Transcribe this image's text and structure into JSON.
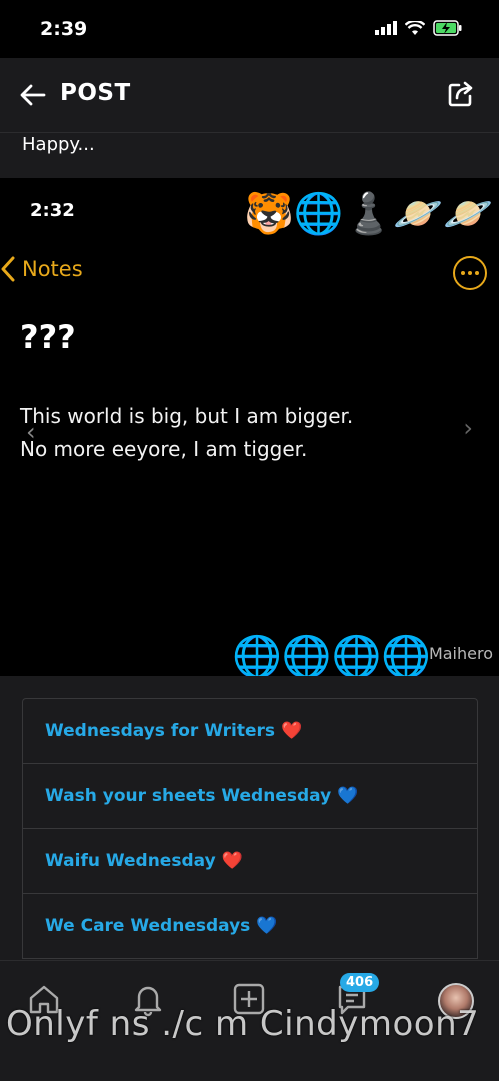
{
  "status_bar": {
    "time": "2:39"
  },
  "nav": {
    "title": "POST"
  },
  "post": {
    "text": "Happy..."
  },
  "embedded_screenshot": {
    "time": "2:32",
    "top_emojis": "🐯🌐♟️🪐🪐",
    "back_label": "Notes",
    "note_title": "???",
    "note_line1": "This world is big, but I am bigger.",
    "note_line2": "No more eeyore, I am tigger.",
    "bottom_emojis": "🌐🌐🌐🌐",
    "corner_name": "Maihero"
  },
  "tags": [
    {
      "label": "Wednesdays for Writers ❤️"
    },
    {
      "label": "Wash your sheets Wednesday 💙"
    },
    {
      "label": "Waifu Wednesday ❤️"
    },
    {
      "label": "We Care Wednesdays 💙"
    }
  ],
  "tabbar": {
    "messages_badge": "406"
  },
  "watermark": "Onlyf ns ./c m Cindymoon7",
  "colors": {
    "accent": "#27a9e6",
    "notes_yellow": "#e8a91b",
    "background": "#1b1b1d"
  }
}
